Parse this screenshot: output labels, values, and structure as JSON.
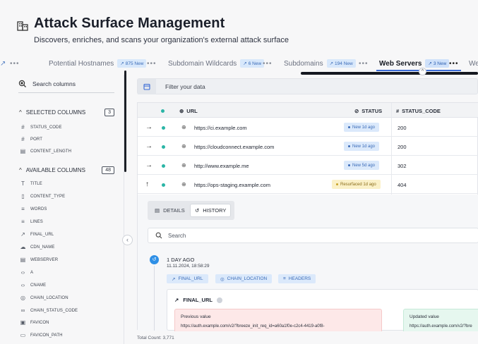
{
  "header": {
    "title": "Attack Surface Management",
    "subtitle": "Discovers, enriches, and scans your organization's external attack surface"
  },
  "tabs": [
    {
      "label": "Potential Hostnames",
      "badge": "875 New"
    },
    {
      "label": "Subdomain Wildcards",
      "badge": "6 New"
    },
    {
      "label": "Subdomains",
      "badge": "194 New"
    },
    {
      "label": "Web Servers",
      "badge": "3 New",
      "active": true
    },
    {
      "label": "We"
    }
  ],
  "columns_panel": {
    "search_placeholder": "Search columns",
    "selected_label": "SELECTED COLUMNS",
    "selected_count": "3",
    "selected": [
      {
        "label": "STATUS_CODE",
        "icon": "hash-icon"
      },
      {
        "label": "PORT",
        "icon": "hash-icon"
      },
      {
        "label": "CONTENT_LENGTH",
        "icon": "file-icon"
      }
    ],
    "available_label": "AVAILABLE COLUMNS",
    "available_count": "48",
    "available": [
      {
        "label": "TITLE",
        "icon": "text-icon"
      },
      {
        "label": "CONTENT_TYPE",
        "icon": "file-icon"
      },
      {
        "label": "WORDS",
        "icon": "lines-icon"
      },
      {
        "label": "LINES",
        "icon": "lines-icon"
      },
      {
        "label": "FINAL_URL",
        "icon": "external-link-icon"
      },
      {
        "label": "CDN_NAME",
        "icon": "cloud-icon"
      },
      {
        "label": "WEBSERVER",
        "icon": "server-icon"
      },
      {
        "label": "A",
        "icon": "code-icon"
      },
      {
        "label": "CNAME",
        "icon": "code-icon"
      },
      {
        "label": "CHAIN_LOCATION",
        "icon": "location-icon"
      },
      {
        "label": "CHAIN_STATUS_CODE",
        "icon": "link-icon"
      },
      {
        "label": "FAVICON",
        "icon": "image-icon"
      },
      {
        "label": "FAVICON_PATH",
        "icon": "folder-icon"
      }
    ]
  },
  "filter": {
    "placeholder": "Filter your data"
  },
  "table": {
    "headers": {
      "url": "URL",
      "status": "STATUS",
      "status_code": "STATUS_CODE"
    },
    "rows": [
      {
        "arrow": "→",
        "url": "https://ci.example.com",
        "status": "New 1d ago",
        "status_type": "new",
        "code": "200"
      },
      {
        "arrow": "→",
        "url": "https://cloudconnect.example.com",
        "status": "New 1d ago",
        "status_type": "new",
        "code": "200"
      },
      {
        "arrow": "→",
        "url": "http://www.example.me",
        "status": "New 5d ago",
        "status_type": "new",
        "code": "302"
      },
      {
        "arrow": "↑",
        "url": "https://ops-staging.example.com",
        "status": "Resurfaced 1d ago",
        "status_type": "resurfaced",
        "code": "404"
      }
    ]
  },
  "detail": {
    "tabs": {
      "details": "DETAILS",
      "history": "HISTORY"
    },
    "search_placeholder": "Search",
    "event": {
      "when": "1 DAY AGO",
      "date": "11.11.2024, 18:58:29",
      "chips": [
        "FINAL_URL",
        "CHAIN_LOCATION",
        "HEADERS"
      ]
    },
    "change": {
      "field": "FINAL_URL",
      "previous_label": "Previous value",
      "previous_value": "https://auth.example.com/v2/?breeze_init_req_id=a60a1f0e-c2c4-4419-a0f8-",
      "updated_label": "Updated value",
      "updated_value": "https://auth.example.com/v2/?bre"
    }
  },
  "footer": {
    "total": "Total Count: 3,771"
  }
}
